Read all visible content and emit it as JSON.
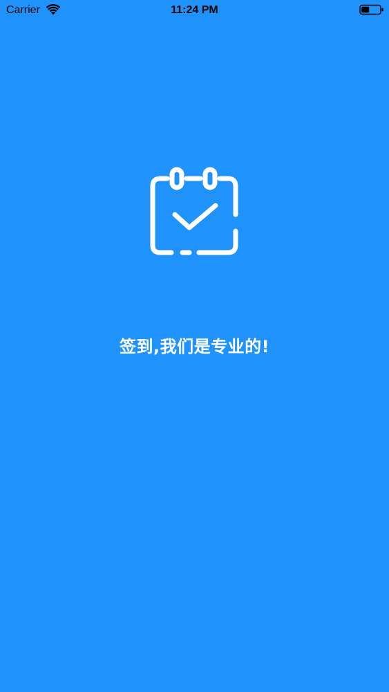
{
  "status_bar": {
    "carrier": "Carrier",
    "time": "11:24 PM",
    "wifi_icon": "wifi-icon",
    "battery_icon": "battery-icon"
  },
  "splash": {
    "logo_icon": "calendar-check-icon",
    "slogan": "签到,我们是专业的!"
  },
  "colors": {
    "background": "#1f93fb",
    "foreground": "#ffffff",
    "status_text": "#000000"
  }
}
